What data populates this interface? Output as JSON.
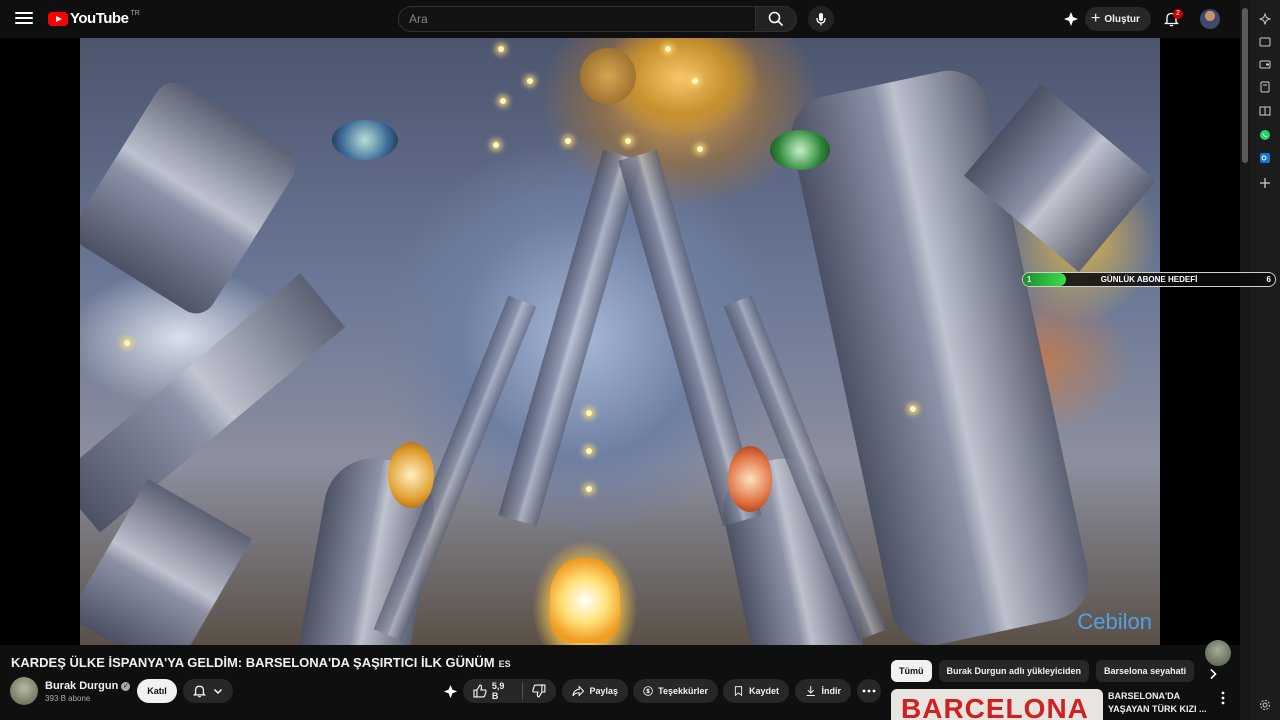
{
  "header": {
    "logo_text": "YouTube",
    "country_code": "TR",
    "search_placeholder": "Ara",
    "create_label": "Oluştur",
    "notification_count": "2"
  },
  "player": {
    "watermark": "Cebilon",
    "subscriber_goal": {
      "start": "1",
      "title": "GÜNLÜK ABONE HEDEFİ",
      "end": "6",
      "progress_fraction": 0.17
    }
  },
  "video": {
    "title": "KARDEŞ ÜLKE İSPANYA'YA GELDİM: BARSELONA'DA ŞAŞIRTICI İLK GÜNÜM",
    "language_badge": "ES"
  },
  "channel": {
    "name": "Burak Durgun",
    "subscribers": "393 B abone",
    "join_label": "Katıl"
  },
  "actions": {
    "like_count": "5,9 B",
    "share_label": "Paylaş",
    "thanks_label": "Teşekkürler",
    "save_label": "Kaydet",
    "download_label": "İndir"
  },
  "chips": [
    "Tümü",
    "Burak Durgun adlı yükleyiciden",
    "Barselona seyahati"
  ],
  "recommendation": {
    "thumb_text": "BARCELONA",
    "title": "BARSELONA'DA YAŞAYAN TÜRK KIZI ..."
  },
  "colors": {
    "background": "#0f0f0f",
    "brand_red": "#ff0000",
    "chip_bg": "#272727",
    "goal_green": "#3ddc4f"
  }
}
